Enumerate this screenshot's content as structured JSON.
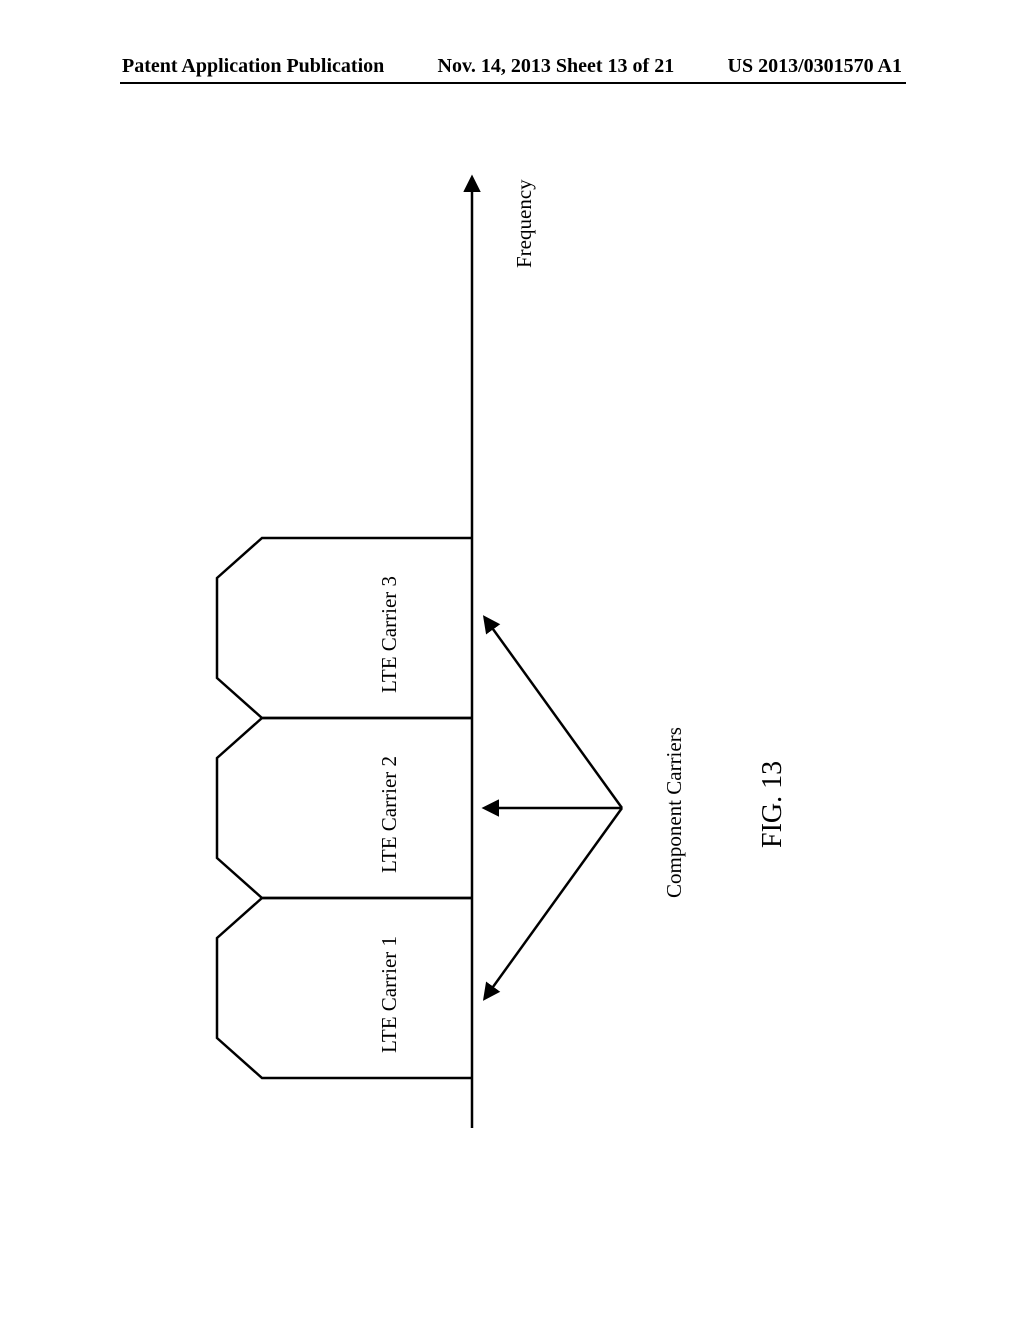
{
  "header": {
    "left": "Patent Application Publication",
    "middle": "Nov. 14, 2013  Sheet 13 of 21",
    "right": "US 2013/0301570 A1"
  },
  "diagram": {
    "carriers": [
      "LTE Carrier 1",
      "LTE Carrier 2",
      "LTE Carrier 3"
    ],
    "component_label": "Component Carriers",
    "axis_label": "Frequency",
    "figure_label": "FIG. 13"
  }
}
